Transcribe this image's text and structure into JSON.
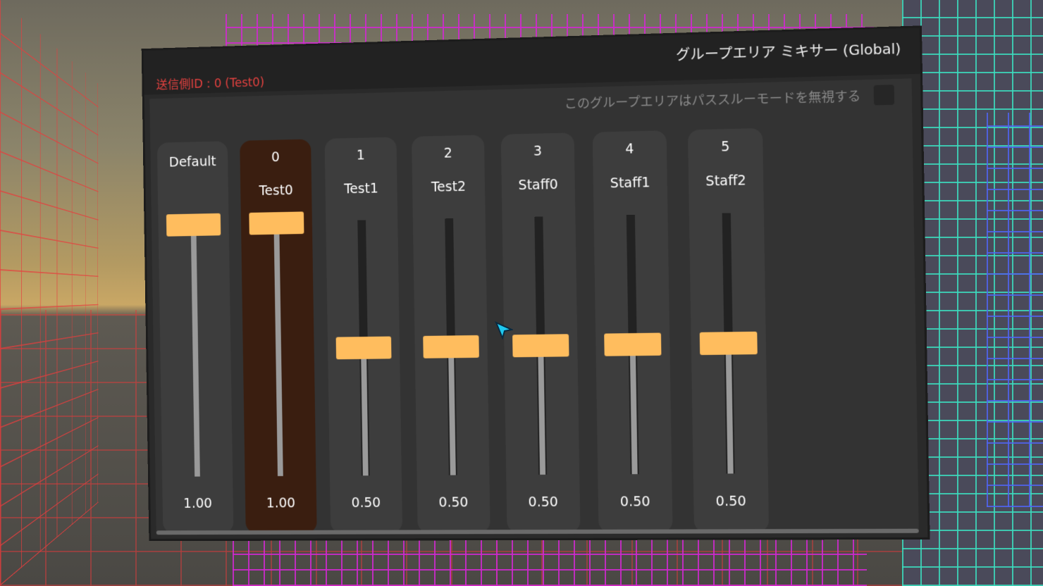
{
  "window": {
    "title": "グループエリア ミキサー (Global)",
    "sender": "送信側ID : 0 (Test0)"
  },
  "options": {
    "ignore_passthrough_label": "このグループエリアはパススルーモードを無視する",
    "ignore_passthrough_checked": false
  },
  "channels": [
    {
      "id": "Default",
      "name": "",
      "value": "1.00",
      "level": 1.0,
      "selected": false
    },
    {
      "id": "0",
      "name": "Test0",
      "value": "1.00",
      "level": 1.0,
      "selected": true
    },
    {
      "id": "1",
      "name": "Test1",
      "value": "0.50",
      "level": 0.5,
      "selected": false
    },
    {
      "id": "2",
      "name": "Test2",
      "value": "0.50",
      "level": 0.5,
      "selected": false
    },
    {
      "id": "3",
      "name": "Staff0",
      "value": "0.50",
      "level": 0.5,
      "selected": false
    },
    {
      "id": "4",
      "name": "Staff1",
      "value": "0.50",
      "level": 0.5,
      "selected": false
    },
    {
      "id": "5",
      "name": "Staff2",
      "value": "0.50",
      "level": 0.5,
      "selected": false
    }
  ],
  "colors": {
    "accent": "#ffbd5e",
    "sender_text": "#e2413f",
    "selected_channel": "#3a1e10"
  }
}
